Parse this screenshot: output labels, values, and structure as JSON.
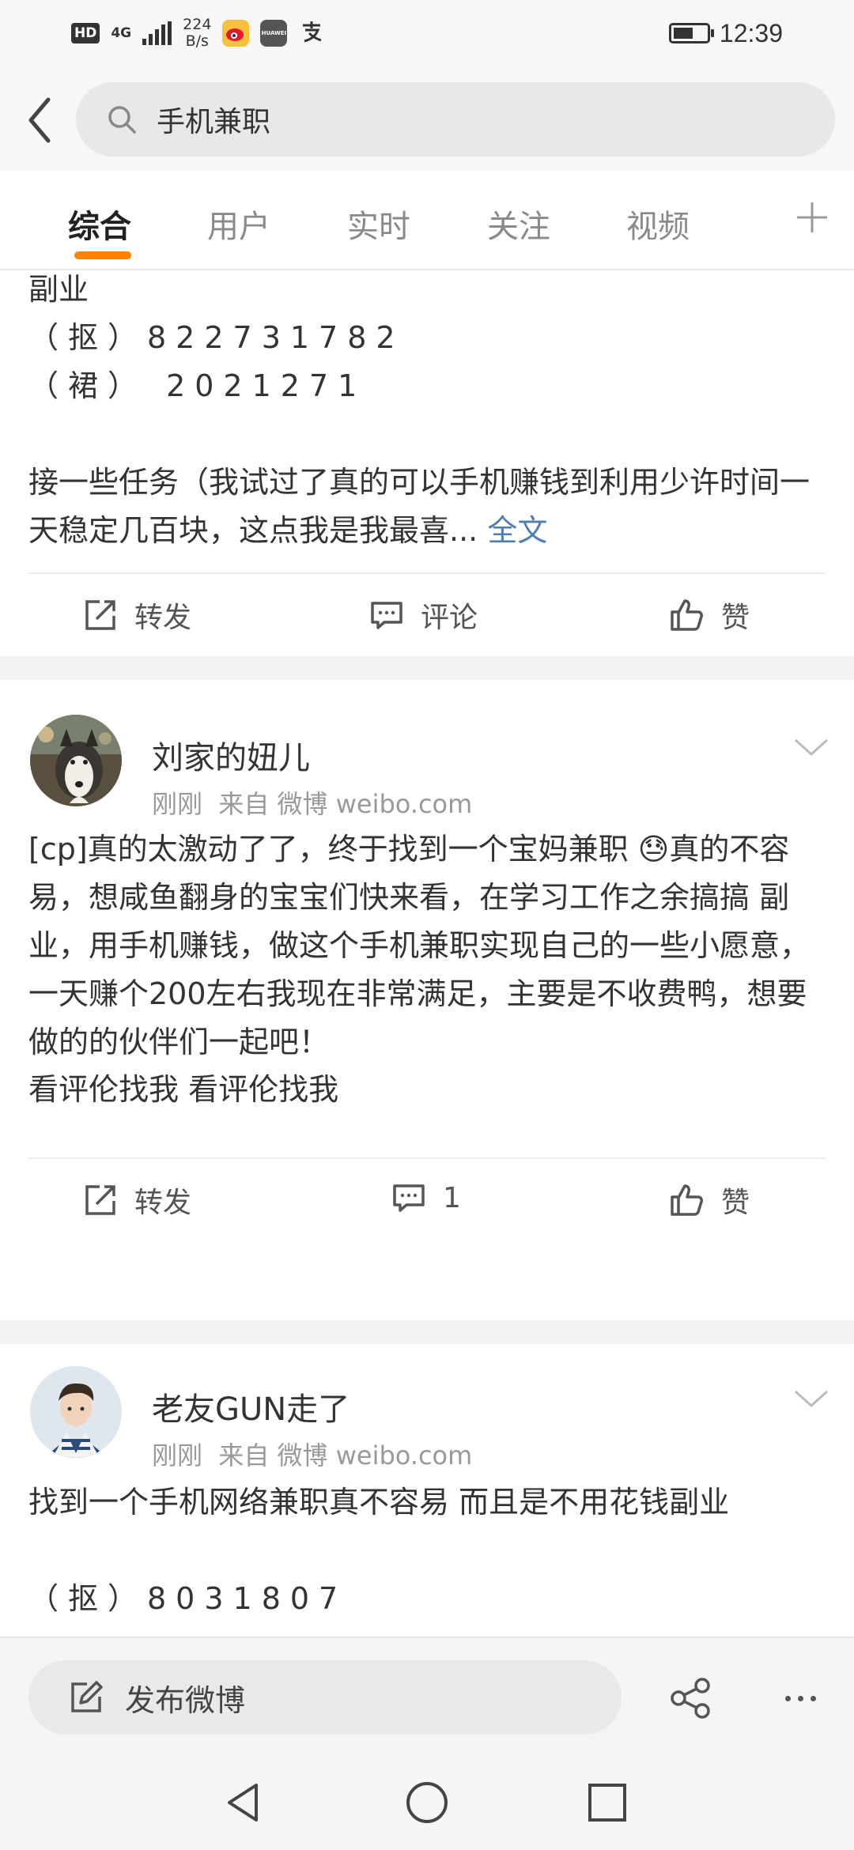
{
  "status_bar": {
    "hd": "HD",
    "network": "4G",
    "speed_value": "224",
    "speed_unit": "B/s",
    "huawei_label": "HUAWEI",
    "time": "12:39"
  },
  "search": {
    "query": "手机兼职"
  },
  "tabs": [
    {
      "label": "综合",
      "active": true
    },
    {
      "label": "用户"
    },
    {
      "label": "实时"
    },
    {
      "label": "关注"
    },
    {
      "label": "视频"
    }
  ],
  "posts": [
    {
      "lines": [
        "副业",
        "（抠）822731782",
        "（裙） 2021271"
      ],
      "text": "接一些任务（我试过了真的可以手机赚钱到利用少许时间一天稳定几百块，这点我是我最喜...",
      "full_text_link": "全文",
      "actions": {
        "repost": "转发",
        "comment": "评论",
        "like": "赞"
      }
    },
    {
      "username": "刘家的妞儿",
      "time": "刚刚",
      "source": "来自 微博 weibo.com",
      "text": "[cp]真的太激动了了，终于找到一个宝妈兼职 😓真的不容易，想咸鱼翻身的宝宝们快来看，在学习工作之余搞搞 副业，用手机赚钱，做这个手机兼职实现自己的一些小愿意，一天赚个200左右我现在非常满足，主要是不收费鸭，想要做的的伙伴们一起吧！",
      "text2": "看评伦找我 看评伦找我",
      "actions": {
        "repost": "转发",
        "comment": "1",
        "like": "赞"
      }
    },
    {
      "username": "老友GUN走了",
      "time": "刚刚",
      "source": "来自 微博 weibo.com",
      "text": "找到一个手机网络兼职真不容易 而且是不用花钱副业",
      "contact": "（抠）8031807"
    }
  ],
  "bottom_bar": {
    "publish_label": "发布微博"
  },
  "colors": {
    "accent": "#ff8200",
    "link": "#507daf",
    "background": "#f2f2f2"
  }
}
